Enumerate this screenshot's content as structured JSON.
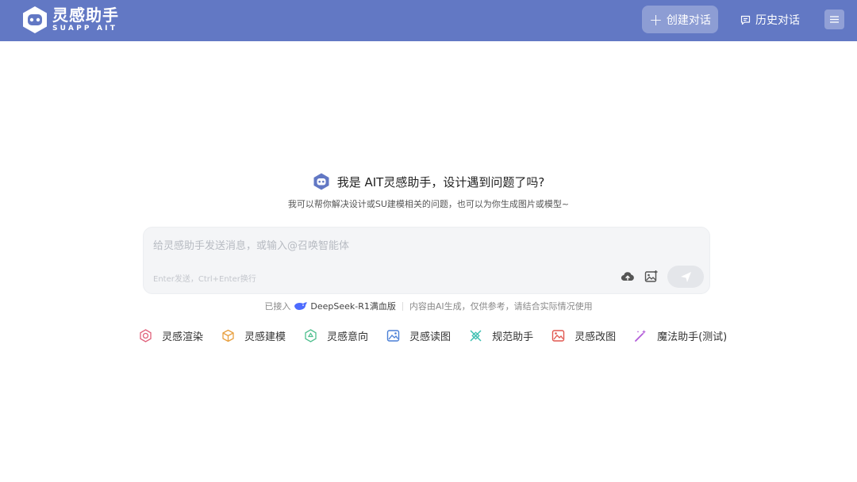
{
  "brand": {
    "name_cn": "灵感助手",
    "name_en": "SUAPP AIT",
    "color": "#6278c4"
  },
  "header": {
    "new_chat_label": "创建对话",
    "history_label": "历史对话"
  },
  "greeting": {
    "title": "我是 AIT灵感助手，设计遇到问题了吗?",
    "subtitle": "我可以帮你解决设计或SU建模相关的问题，也可以为你生成图片或模型~"
  },
  "composer": {
    "placeholder": "给灵感助手发送消息，或输入@召唤智能体",
    "hint": "Enter发送，Ctrl+Enter换行"
  },
  "footer": {
    "connected_prefix": "已接入",
    "model_name": "DeepSeek-R1满血版",
    "disclaimer": "内容由AI生成，仅供参考，请结合实际情况使用"
  },
  "tools": [
    {
      "label": "灵感渲染",
      "icon": "render-icon",
      "color": "#e0607a"
    },
    {
      "label": "灵感建模",
      "icon": "cube-icon",
      "color": "#e8a040"
    },
    {
      "label": "灵感意向",
      "icon": "intent-icon",
      "color": "#4fbf8e"
    },
    {
      "label": "灵感读图",
      "icon": "read-image-icon",
      "color": "#4a7fd6"
    },
    {
      "label": "规范助手",
      "icon": "spec-icon",
      "color": "#3dbfb1"
    },
    {
      "label": "灵感改图",
      "icon": "edit-image-icon",
      "color": "#e0564e"
    },
    {
      "label": "魔法助手(测试)",
      "icon": "magic-wand-icon",
      "color": "#b25ad8"
    }
  ]
}
